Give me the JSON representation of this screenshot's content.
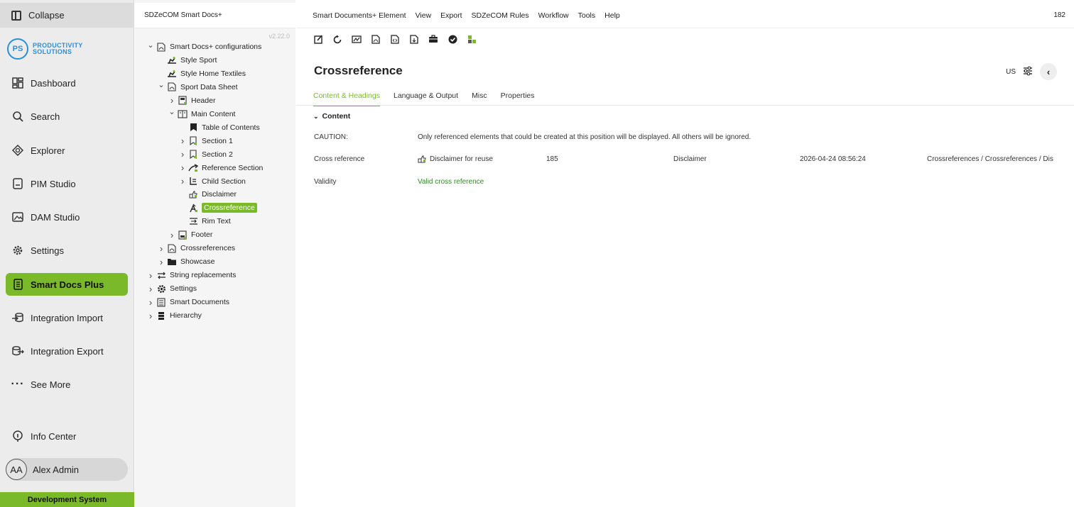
{
  "nav": {
    "collapse": "Collapse",
    "logo_initials": "PS",
    "logo_line1": "PRODUCTIVITY",
    "logo_line2": "SOLUTIONS",
    "items": [
      {
        "label": "Dashboard",
        "icon": "dashboard-icon"
      },
      {
        "label": "Search",
        "icon": "search-icon"
      },
      {
        "label": "Explorer",
        "icon": "explorer-icon"
      },
      {
        "label": "PIM Studio",
        "icon": "pim-studio-icon"
      },
      {
        "label": "DAM Studio",
        "icon": "dam-studio-icon"
      },
      {
        "label": "Settings",
        "icon": "gear-icon"
      },
      {
        "label": "Smart Docs Plus",
        "icon": "smart-docs-icon",
        "active": true
      },
      {
        "label": "Integration Import",
        "icon": "import-icon"
      },
      {
        "label": "Integration Export",
        "icon": "export-icon"
      },
      {
        "label": "See More",
        "icon": "more-icon"
      }
    ],
    "info_center": "Info Center",
    "user_initials": "AA",
    "user_name": "Alex Admin",
    "environment": "Development System",
    "accent": "#7ab929"
  },
  "tree": {
    "title": "SDZeCOM Smart Docs+",
    "version": "v2.22.0",
    "nodes": [
      {
        "label": "Smart Docs+ configurations",
        "depth": 0,
        "expanded": true,
        "icon": "pdf-icon"
      },
      {
        "label": "Style Sport",
        "depth": 1,
        "icon": "style-icon"
      },
      {
        "label": "Style Home Textiles",
        "depth": 1,
        "icon": "style-icon"
      },
      {
        "label": "Sport Data Sheet",
        "depth": 1,
        "expanded": true,
        "icon": "pdf-icon"
      },
      {
        "label": "Header",
        "depth": 2,
        "collapsed": true,
        "icon": "header-icon"
      },
      {
        "label": "Main Content",
        "depth": 2,
        "expanded": true,
        "icon": "content-icon"
      },
      {
        "label": "Table of Contents",
        "depth": 3,
        "icon": "bookmark-icon"
      },
      {
        "label": "Section 1",
        "depth": 3,
        "collapsed": true,
        "icon": "section-icon"
      },
      {
        "label": "Section 2",
        "depth": 3,
        "collapsed": true,
        "icon": "section-icon"
      },
      {
        "label": "Reference Section",
        "depth": 3,
        "collapsed": true,
        "icon": "reference-icon"
      },
      {
        "label": "Child Section",
        "depth": 3,
        "collapsed": true,
        "icon": "child-section-icon"
      },
      {
        "label": "Disclaimer",
        "depth": 3,
        "icon": "disclaimer-icon"
      },
      {
        "label": "Crossreference",
        "depth": 3,
        "icon": "crossreference-icon",
        "selected": true
      },
      {
        "label": "Rim Text",
        "depth": 3,
        "icon": "rim-text-icon"
      },
      {
        "label": "Footer",
        "depth": 2,
        "collapsed": true,
        "icon": "footer-icon"
      },
      {
        "label": "Crossreferences",
        "depth": 1,
        "collapsed": true,
        "icon": "pdf-icon"
      },
      {
        "label": "Showcase",
        "depth": 1,
        "collapsed": true,
        "icon": "folder-icon"
      },
      {
        "label": "String replacements",
        "depth": 0,
        "collapsed": true,
        "icon": "swap-icon"
      },
      {
        "label": "Settings",
        "depth": 0,
        "collapsed": true,
        "icon": "gear-icon"
      },
      {
        "label": "Smart Documents",
        "depth": 0,
        "collapsed": true,
        "icon": "document-icon"
      },
      {
        "label": "Hierarchy",
        "depth": 0,
        "collapsed": true,
        "icon": "hierarchy-icon"
      }
    ]
  },
  "menu": [
    "Smart Documents+ Element",
    "View",
    "Export",
    "SDZeCOM Rules",
    "Workflow",
    "Tools",
    "Help"
  ],
  "counter": "182",
  "page_title": "Crossreference",
  "locale": "US",
  "tabs": [
    "Content & Headings",
    "Language & Output",
    "Misc",
    "Properties"
  ],
  "section_label": "Content",
  "caution_label": "CAUTION:",
  "caution_text": "Only referenced elements that could be created at this position will be displayed. All others will be ignored.",
  "crossref_label": "Cross reference",
  "crossref": {
    "name": "Disclaimer for reuse",
    "id": "185",
    "type": "Disclaimer",
    "date": "2026-04-24 08:56:24",
    "path": "Crossreferences / Crossreferences / Disc"
  },
  "validity_label": "Validity",
  "validity_value": "Valid cross reference"
}
